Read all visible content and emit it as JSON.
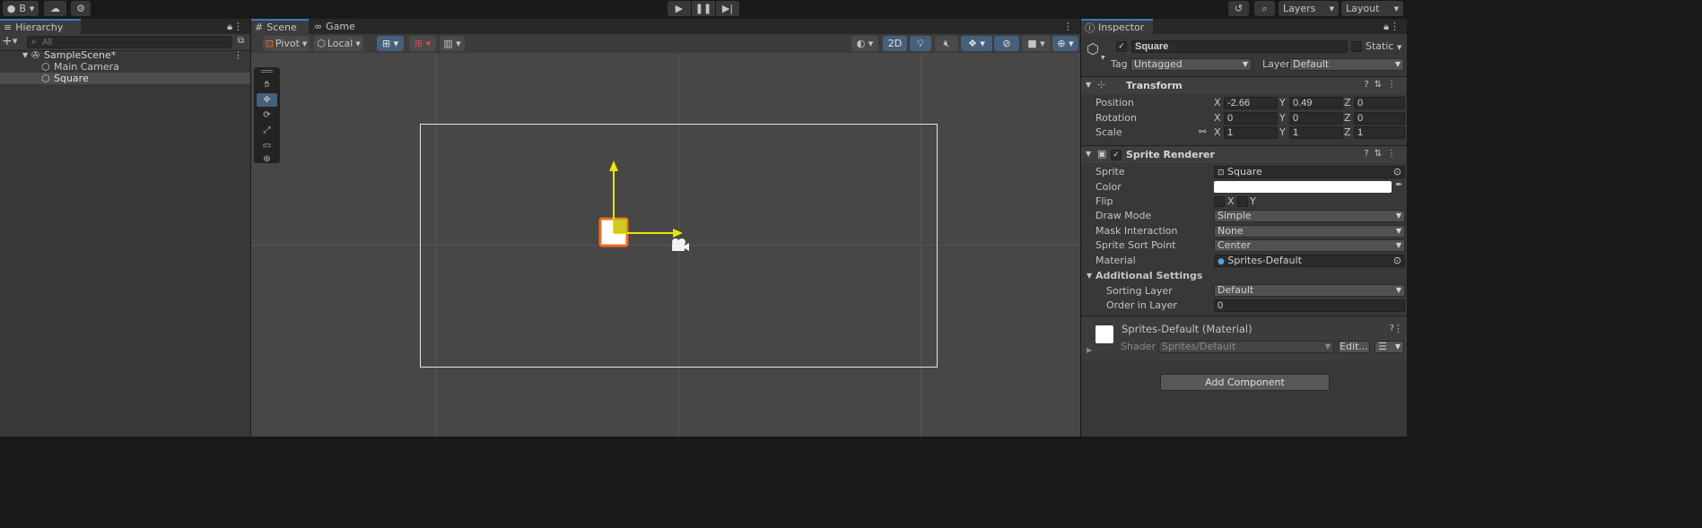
{
  "toolbar": {
    "account_label": "B",
    "layers_label": "Layers",
    "layout_label": "Layout"
  },
  "hierarchy": {
    "tab_label": "Hierarchy",
    "search_placeholder": "All",
    "items": [
      {
        "label": "SampleScene*",
        "indent": 0
      },
      {
        "label": "Main Camera",
        "indent": 1
      },
      {
        "label": "Square",
        "indent": 1
      }
    ]
  },
  "scene": {
    "tabs": [
      {
        "label": "Scene"
      },
      {
        "label": "Game"
      }
    ],
    "pivot_label": "Pivot",
    "local_label": "Local",
    "mode_2d_label": "2D"
  },
  "inspector": {
    "tab_label": "Inspector",
    "object_name": "Square",
    "static_label": "Static",
    "tag_label": "Tag",
    "tag_value": "Untagged",
    "layer_label": "Layer",
    "layer_value": "Default",
    "transform": {
      "title": "Transform",
      "position_label": "Position",
      "rotation_label": "Rotation",
      "scale_label": "Scale",
      "position": {
        "x": "-2.66",
        "y": "0.49",
        "z": "0"
      },
      "rotation": {
        "x": "0",
        "y": "0",
        "z": "0"
      },
      "scale": {
        "x": "1",
        "y": "1",
        "z": "1"
      }
    },
    "sprite_renderer": {
      "title": "Sprite Renderer",
      "sprite_label": "Sprite",
      "sprite_value": "Square",
      "color_label": "Color",
      "color_value": "#ffffff",
      "flip_label": "Flip",
      "flip_x": "X",
      "flip_y": "Y",
      "draw_mode_label": "Draw Mode",
      "draw_mode_value": "Simple",
      "mask_label": "Mask Interaction",
      "mask_value": "None",
      "sort_point_label": "Sprite Sort Point",
      "sort_point_value": "Center",
      "material_label": "Material",
      "material_value": "Sprites-Default",
      "additional_label": "Additional Settings",
      "sorting_layer_label": "Sorting Layer",
      "sorting_layer_value": "Default",
      "order_label": "Order in Layer",
      "order_value": "0"
    },
    "material": {
      "title": "Sprites-Default (Material)",
      "shader_label": "Shader",
      "shader_value": "Sprites/Default",
      "edit_label": "Edit..."
    },
    "add_component_label": "Add Component"
  },
  "colors": {
    "accent": "#3a79bb",
    "selection_orange": "#f26b21",
    "gizmo_yellow": "#e6e600"
  }
}
